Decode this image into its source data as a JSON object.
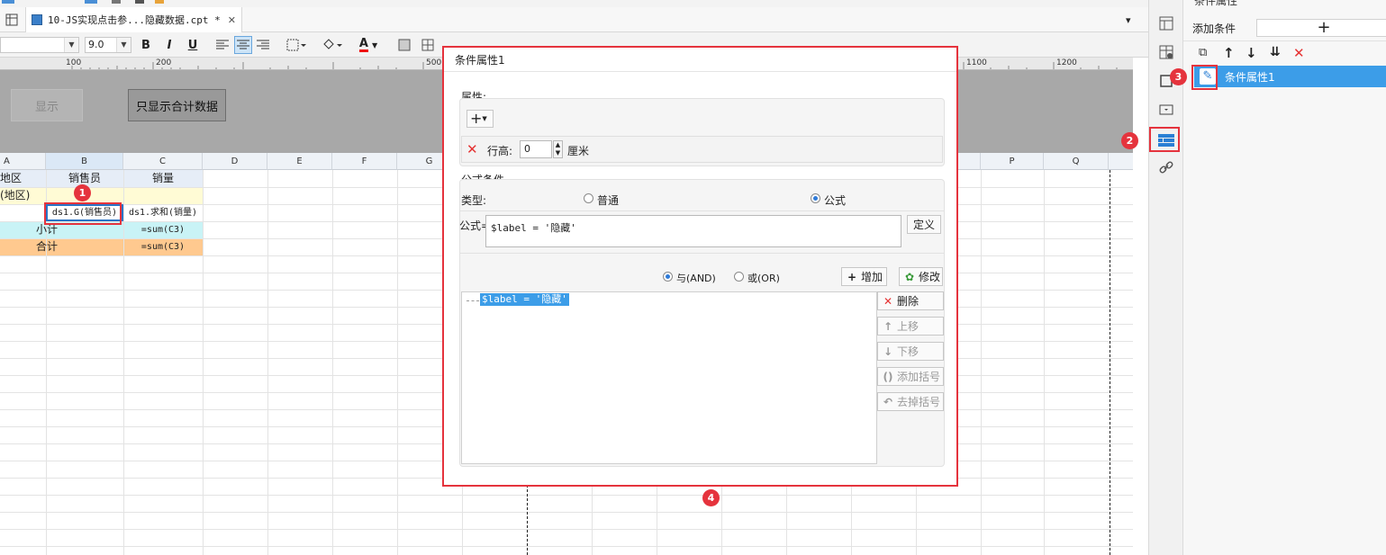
{
  "tabs": {
    "active_title": "10-JS实现点击参...隐藏数据.cpt *",
    "close_glyph": "✕"
  },
  "toolbar": {
    "font_size": "9.0",
    "bold": "B",
    "italic": "I",
    "underline": "U",
    "font_color": "A"
  },
  "ruler": {
    "marks": [
      "100",
      "200",
      "500",
      "1100",
      "1200"
    ]
  },
  "params": {
    "show_button": "显示",
    "total_button": "只显示合计数据"
  },
  "grid": {
    "columns": [
      "A",
      "B",
      "C",
      "D",
      "E",
      "F",
      "G",
      "P",
      "Q"
    ],
    "header_row": {
      "a": "地区",
      "b": "销售员",
      "c": "销量"
    },
    "row2": {
      "a": "(地区)"
    },
    "row3": {
      "b": "ds1.G(销售员)",
      "c": "ds1.求和(销量)"
    },
    "subtotal": {
      "label": "小计",
      "formula": "=sum(C3)"
    },
    "total": {
      "label": "合计",
      "formula": "=sum(C3)"
    }
  },
  "dialog": {
    "title": "条件属性1",
    "attributes_label": "属性:",
    "row_height_label": "行高:",
    "row_height_value": "0",
    "unit": "厘米",
    "formula_condition_label": "公式条件",
    "type_label": "类型:",
    "type_normal": "普通",
    "type_formula": "公式",
    "formula_label": "公式=",
    "formula_value": "$label = '隐藏'",
    "define_button": "定义",
    "and_label": "与(AND)",
    "or_label": "或(OR)",
    "add_button": "增加",
    "modify_button": "修改",
    "delete_button": "删除",
    "up_button": "上移",
    "down_button": "下移",
    "add_bracket_button": "添加括号",
    "remove_bracket_button": "去掉括号",
    "condition_item": "$label = '隐藏'"
  },
  "right_panel": {
    "header": "条件属性",
    "add_condition_label": "添加条件",
    "add_glyph": "+",
    "list_item": "条件属性1"
  },
  "annotations": [
    "1",
    "2",
    "3",
    "4"
  ],
  "colors": {
    "accent": "#e5333d",
    "selection": "#3c9de8",
    "header_row_bg": "#e6edf7",
    "row2_bg": "#fffbd5",
    "subtotal_bg": "#c9f3f6",
    "total_bg": "#ffc98f"
  }
}
